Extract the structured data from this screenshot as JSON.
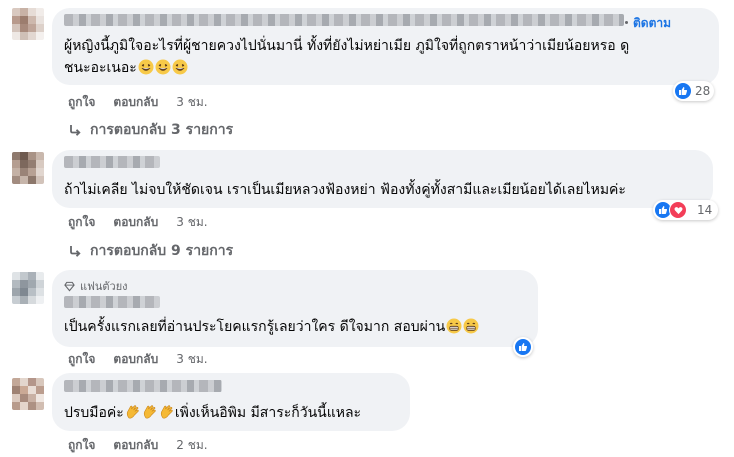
{
  "comments": [
    {
      "follow_label": "ติดตาม",
      "text_line1": "ผู้หญิงนี้ภูมิใจอะไรที่ผู้ชายควงไปนั่นมานี่ ทั้งที่ยังไม่หย่าเมีย ภูมิใจที่ถูกตราหน้าว่าเมียน้อยหรอ ดู",
      "text_line2": "ชนะอะเนอะ",
      "like_label": "ถูกใจ",
      "reply_label": "ตอบกลับ",
      "time": "3 ชม.",
      "reaction_count": "28",
      "replies_label": "การตอบกลับ 3 รายการ"
    },
    {
      "text_line1": "ถ้าไม่เคลีย ไม่จบให้ชัดเจน เราเป็นเมียหลวงฟ้องหย่า ฟ้องทั้งคู่ทั้งสามีและเมียน้อยได้เลยไหมค่ะ",
      "like_label": "ถูกใจ",
      "reply_label": "ตอบกลับ",
      "time": "3 ชม.",
      "reaction_count": "14",
      "replies_label": "การตอบกลับ 9 รายการ"
    },
    {
      "badge_label": "แฟนตัวยง",
      "text_line1": "เป็นครั้งแรกเลยที่อ่านประโยคแรกรู้เลยว่าใคร ดีใจมาก สอบผ่าน",
      "like_label": "ถูกใจ",
      "reply_label": "ตอบกลับ",
      "time": "3 ชม."
    },
    {
      "text_pre": "ปรบมือค่ะ",
      "text_post": "เพิ่งเห็นอิพิม มีสาระก็วันนี้แหละ",
      "like_label": "ถูกใจ",
      "reply_label": "ตอบกลับ",
      "time": "2 ชม."
    }
  ],
  "colors": {
    "bubble": "#f0f2f5",
    "link_blue": "#1b74e4",
    "meta_gray": "#65676b",
    "like_blue": "#1877f2",
    "love_red": "#f33e58"
  },
  "icons": [
    "avatar",
    "grin-emoji",
    "grimace-emoji",
    "clap-emoji",
    "reply-arrow-icon",
    "diamond-badge-icon",
    "like-reaction-icon",
    "love-reaction-icon"
  ]
}
